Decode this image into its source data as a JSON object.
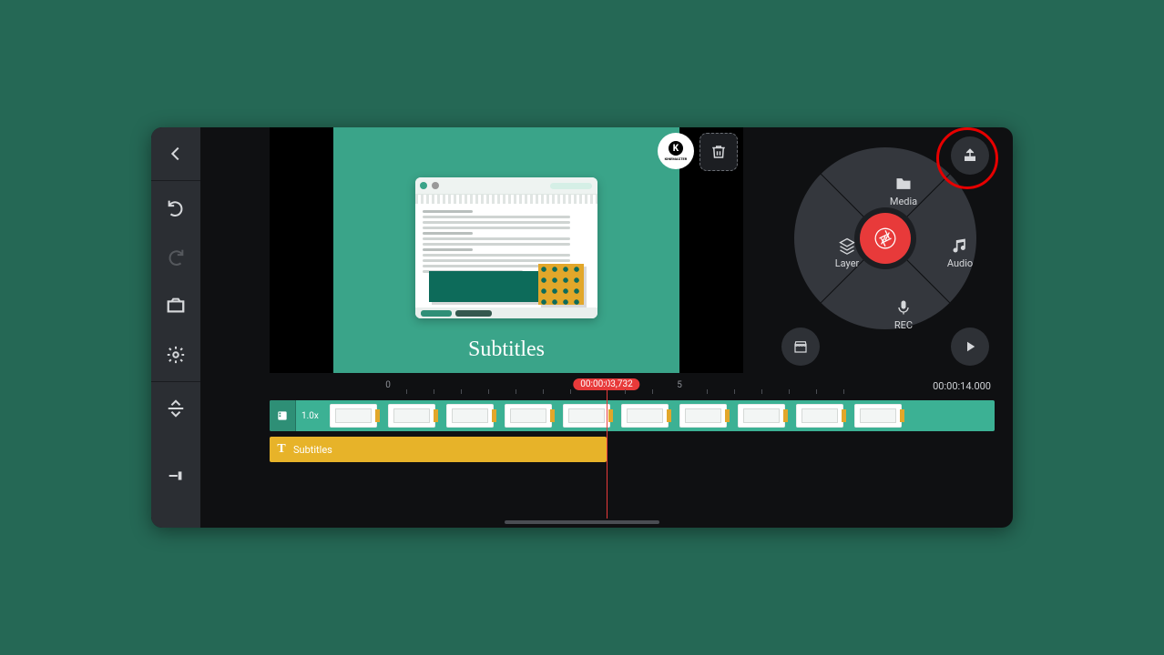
{
  "sidebar": {
    "back": "Back",
    "undo": "Undo",
    "redo": "Redo",
    "capture": "Capture frame",
    "settings": "Settings",
    "timeline_expand": "Expand timeline",
    "jump_end": "Jump to end"
  },
  "preview": {
    "watermark": "KINEMASTER",
    "caption": "Subtitles",
    "trash": "Delete"
  },
  "wheel": {
    "media": "Media",
    "layer": "Layer",
    "audio": "Audio",
    "rec": "REC",
    "shutter": "Capture",
    "store": "Asset Store",
    "share": "Export / Share",
    "play": "Play"
  },
  "timeline": {
    "tick0": "0",
    "tick5": "5",
    "playhead_time": "00:00:03,732",
    "duration": "00:00:14.000",
    "speed": "1.0x",
    "text_track_label": "Subtitles"
  },
  "annotation": {
    "share_highlight": "Share button highlighted"
  }
}
